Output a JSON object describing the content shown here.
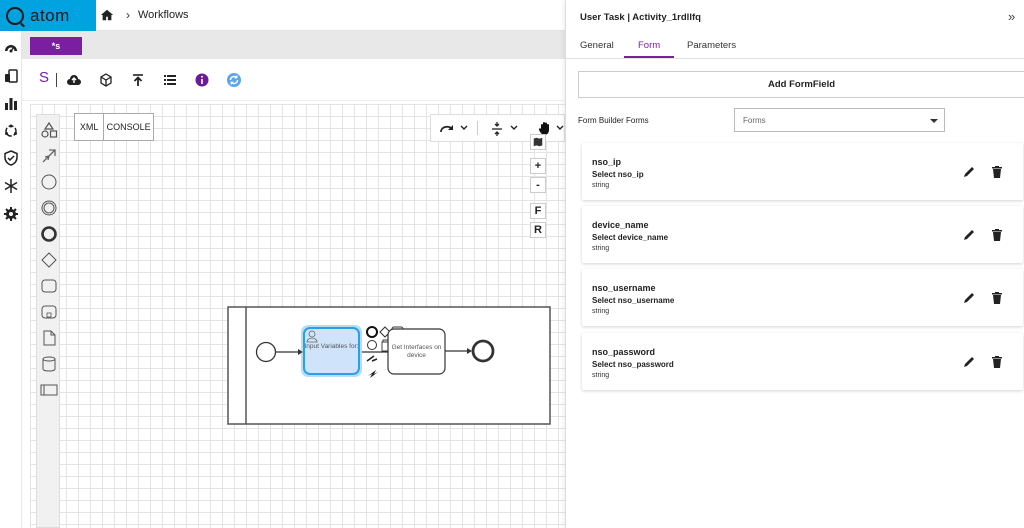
{
  "app": {
    "brand": "atom"
  },
  "header": {
    "breadcrumb_current": "Workflows"
  },
  "tabs": {
    "active_label": "*s"
  },
  "toolbar": {
    "s_label": "S"
  },
  "canvas": {
    "xml_label": "XML",
    "console_label": "CONSOLE",
    "zoom_in": "+",
    "zoom_out": "-",
    "fit_label": "F",
    "reset_label": "R",
    "task1_label": "Input Variables for:",
    "task2_label": "Get Interfaces on device"
  },
  "panel": {
    "title": "User Task | Activity_1rdllfq",
    "tabs": [
      {
        "label": "General"
      },
      {
        "label": "Form"
      },
      {
        "label": "Parameters"
      }
    ],
    "active_tab": "Form",
    "add_button": "Add FormField",
    "form_builder_label": "Form Builder Forms",
    "forms_select_placeholder": "Forms",
    "fields": [
      {
        "name": "nso_ip",
        "label": "Select nso_ip",
        "type": "string"
      },
      {
        "name": "device_name",
        "label": "Select device_name",
        "type": "string"
      },
      {
        "name": "nso_username",
        "label": "Select nso_username",
        "type": "string"
      },
      {
        "name": "nso_password",
        "label": "Select nso_password",
        "type": "string"
      }
    ]
  },
  "colors": {
    "brand": "#00a3e0",
    "accent": "#7b1fa2",
    "selected_task_fill": "#cfe3fb",
    "selected_task_stroke": "#2aa0e6"
  }
}
